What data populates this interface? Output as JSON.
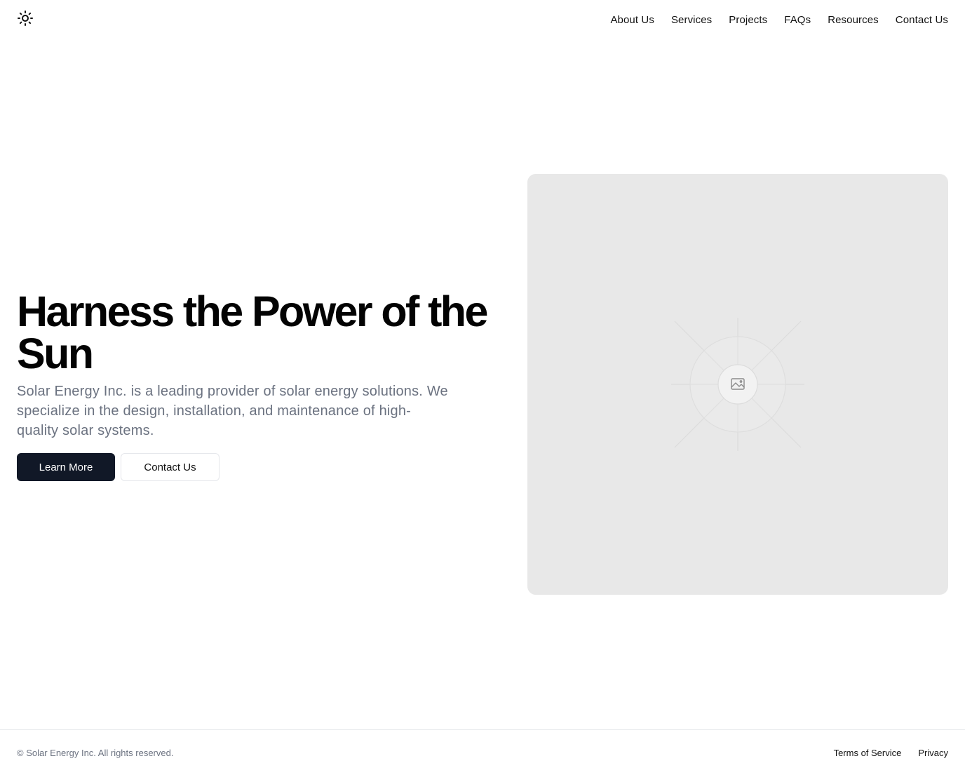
{
  "header": {
    "logo_icon": "sun-icon",
    "nav": [
      {
        "label": "About Us"
      },
      {
        "label": "Services"
      },
      {
        "label": "Projects"
      },
      {
        "label": "FAQs"
      },
      {
        "label": "Resources"
      },
      {
        "label": "Contact Us"
      }
    ]
  },
  "hero": {
    "title": "Harness the Power of the Sun",
    "description": "Solar Energy Inc. is a leading provider of solar energy solutions. We specialize in the design, installation, and maintenance of high-quality solar systems.",
    "primary_button": "Learn More",
    "secondary_button": "Contact Us",
    "image_icon": "image-placeholder-icon"
  },
  "footer": {
    "copyright": "© Solar Energy Inc. All rights reserved.",
    "links": [
      {
        "label": "Terms of Service"
      },
      {
        "label": "Privacy"
      }
    ]
  },
  "colors": {
    "primary_button_bg": "#111827",
    "text_muted": "#6b7280",
    "placeholder_bg": "#e8e8e8",
    "border": "#e5e7eb"
  }
}
